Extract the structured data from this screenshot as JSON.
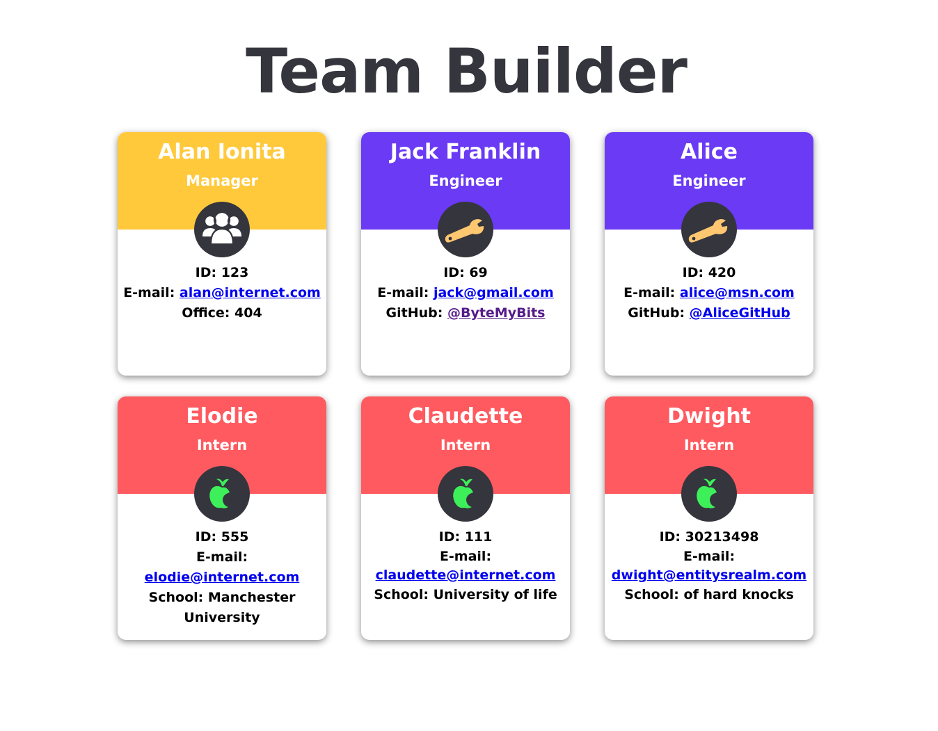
{
  "page_title": "Team Builder",
  "colors": {
    "manager": "#ffc93b",
    "engineer": "#6a3af5",
    "intern": "#ff5a5f",
    "icon_bg": "#35353d",
    "wrench": "#ffc870",
    "apple": "#3df05a"
  },
  "cards": [
    {
      "name": "Alan Ionita",
      "role": "Manager",
      "icon": "people-icon",
      "id_label": "ID:",
      "id": "123",
      "email_label": "E-mail:",
      "email": "alan@internet.com",
      "extra_label": "Office:",
      "extra_value": "404"
    },
    {
      "name": "Jack Franklin",
      "role": "Engineer",
      "icon": "wrench-icon",
      "id_label": "ID:",
      "id": "69",
      "email_label": "E-mail:",
      "email": "jack@gmail.com",
      "extra_label": "GitHub:",
      "extra_value": "@ByteMyBits"
    },
    {
      "name": "Alice",
      "role": "Engineer",
      "icon": "wrench-icon",
      "id_label": "ID:",
      "id": "420",
      "email_label": "E-mail:",
      "email": "alice@msn.com",
      "extra_label": "GitHub:",
      "extra_value": "@AliceGitHub"
    },
    {
      "name": "Elodie",
      "role": "Intern",
      "icon": "apple-icon",
      "id_label": "ID:",
      "id": "555",
      "email_label": "E-mail:",
      "email": "elodie@internet.com",
      "extra_label": "School:",
      "extra_value": "Manchester University"
    },
    {
      "name": "Claudette",
      "role": "Intern",
      "icon": "apple-icon",
      "id_label": "ID:",
      "id": "111",
      "email_label": "E-mail:",
      "email": "claudette@internet.com",
      "extra_label": "School:",
      "extra_value": "University of life"
    },
    {
      "name": "Dwight",
      "role": "Intern",
      "icon": "apple-icon",
      "id_label": "ID:",
      "id": "30213498",
      "email_label": "E-mail:",
      "email": "dwight@entitysrealm.com",
      "extra_label": "School:",
      "extra_value": "of hard knocks"
    }
  ]
}
